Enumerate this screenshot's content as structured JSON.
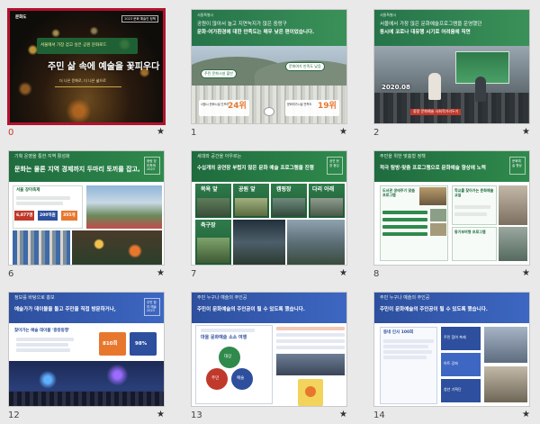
{
  "slides": [
    {
      "index": "0",
      "logo": "문화도",
      "corner_badge": "2023 문화 예술인 정책",
      "title_small": "서울에서 가장 걷고 싶은 공원 문화로드",
      "title_main": "주민 삶 속에 예술을 꽃피우다",
      "subtitle": "더 나은 문화로, 더 나은 삶으로"
    },
    {
      "index": "1",
      "tag": "서울특별시",
      "title_line1": "공원이 많아서 놀고 지연녹지가 많은 중랑구",
      "title_line2": "문화·여가환경에 대한 만족도는 매우 낮은 편이었습니다.",
      "left_stat_label": "서울시 문화시설 인프라",
      "left_stat_value": "24위",
      "right_stat_label": "문화여가시설 만족도",
      "right_stat_value": "19위",
      "left_pill": "주민 문화시설 불만",
      "right_pill": "문화여가 만족도 낮음"
    },
    {
      "index": "2",
      "tag": "서울특별시",
      "title_line1": "서울에서 가장 많은 문화예술프로그램을 운영했던",
      "title_line2": "동시에 코로나 대유행 시기로 어려움에 직면",
      "year_label": "2020.08",
      "banner_text": "중랑 문화예술 사회적거리두기"
    },
    {
      "index": "6",
      "tag": "기획 운영을 통한 지역 활성화",
      "title": "문화는 물론 지역 경제까지 두마리 토끼를 잡고,",
      "box_title": "서울 장미축제",
      "stat1": "6,877명",
      "stat2": "200억원",
      "stat3": "355개",
      "badge": "중랑 장미축제 2023"
    },
    {
      "index": "7",
      "tag": "세대와 공간을 아우르는",
      "title": "수십개의 공연장 부럽지 않은 문화 예술 프로그램을 진행",
      "badge": "공연 현장 중심",
      "tile1": "목욕 앞",
      "tile2": "공원 앞",
      "tile3": "캠핑장",
      "tile4": "다리 아래",
      "tile5": "축구장"
    },
    {
      "index": "8",
      "tag": "주민을 위한 맞춤형 정책",
      "title": "적극 탐방·맞춤 프로그램으로 문화예술 향상에 노력",
      "badge": "문화예술 향상",
      "card1": "도서관 생애주기 맞춤 프로그램",
      "card2": "학교를 찾아가는 문화예술 교실",
      "card3": "동기부여형 프로그램"
    },
    {
      "index": "12",
      "tag": "정보를 바탕으로 홍보",
      "title": "예술가가 데이블을 돌고 주민을 직접 방문하거나,",
      "box_title": "찾아가는 예술 데이블 '중랑동행'",
      "stat1": "810회",
      "stat2": "98%",
      "badge": "주민 참여 예술 2023"
    },
    {
      "index": "13",
      "tag": "주민 누구나 예술의 주인공",
      "title": "주민이 문화예술의 주인공이 될 수 있도록 했습니다.",
      "left_title": "마을 문화예술 소소 여행",
      "circle1": "대상",
      "circle2": "주민",
      "circle3": "예술"
    },
    {
      "index": "14",
      "tag": "주민 누구나 예술의 주인공",
      "title": "주민이 문화예술의 주인공이 될 수 있도록 했습니다.",
      "card_title": "동네 인사 100회",
      "box1": "주민 참여 축제",
      "box2": "아트 강좌",
      "box3": "청년 기획단"
    }
  ],
  "star_glyph": "★",
  "colors": {
    "green_dark": "#1f6b3e",
    "green": "#2f8a4c",
    "blue": "#2d4f9e",
    "selected": "#b3122e",
    "orange": "#e8772e",
    "red": "#c0392b"
  }
}
